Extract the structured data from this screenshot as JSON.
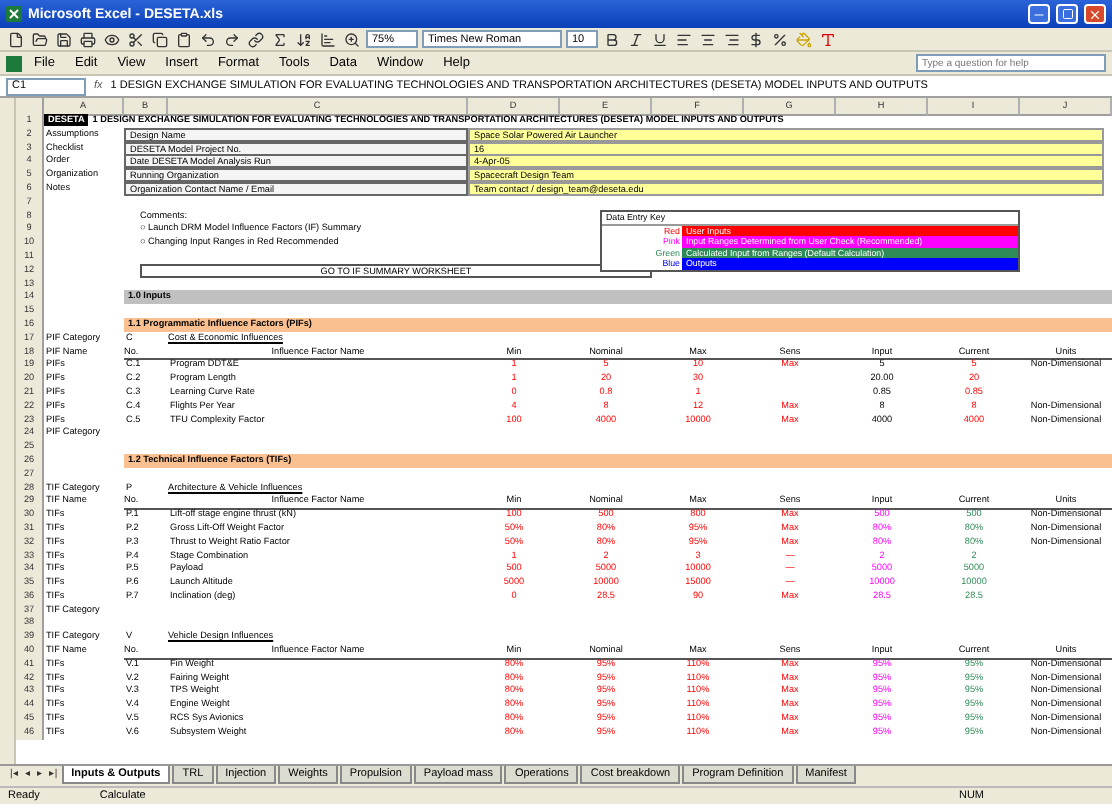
{
  "window": {
    "title": "Microsoft Excel - DESETA.xls"
  },
  "menu": [
    "File",
    "Edit",
    "View",
    "Insert",
    "Format",
    "Tools",
    "Data",
    "Window",
    "Help"
  ],
  "help_box": {
    "placeholder": "Type a question for help"
  },
  "toolbar": {
    "zoom": "75%",
    "font": "Times New Roman",
    "size": "10"
  },
  "formula_bar": {
    "name_box": "C1",
    "fx": "fx",
    "formula": "1 DESIGN EXCHANGE SIMULATION FOR EVALUATING TECHNOLOGIES AND TRANSPORTATION ARCHITECTURES (DESETA) MODEL INPUTS AND OUTPUTS"
  },
  "columns": [
    "A",
    "B",
    "C",
    "D",
    "E",
    "F",
    "G",
    "H",
    "I",
    "J"
  ],
  "data_entry_key": {
    "title": "Data Entry Key",
    "items": [
      {
        "label": "Red",
        "text": "User Inputs",
        "color": "#ff0000"
      },
      {
        "label": "Pink",
        "text": "Input Ranges Determined from User Check (Recommended)",
        "color": "#ff00ff"
      },
      {
        "label": "Green",
        "text": "Calculated Input from Ranges (Default Calculation)",
        "color": "#2e8b57"
      },
      {
        "label": "Blue",
        "text": "Outputs",
        "color": "#0000ff"
      }
    ]
  },
  "rows": [
    {
      "n": "1",
      "kind": "title",
      "badge": "DESETA",
      "text": "1 DESIGN EXCHANGE SIMULATION FOR EVALUATING TECHNOLOGIES AND TRANSPORTATION ARCHITECTURES (DESETA) MODEL INPUTS AND OUTPUTS"
    },
    {
      "n": "2",
      "kind": "info",
      "label": "Assumptions",
      "field": "Design Name",
      "value": "Space Solar Powered Air Launcher"
    },
    {
      "n": "3",
      "kind": "info",
      "label": "Checklist",
      "field": "DESETA Model Project No.",
      "value": "16"
    },
    {
      "n": "4",
      "kind": "info",
      "label": "Order",
      "field": "Date DESETA Model Analysis Run",
      "value": "4-Apr-05"
    },
    {
      "n": "5",
      "kind": "info",
      "label": "Organization",
      "field": "Running Organization",
      "value": "Spacecraft Design Team"
    },
    {
      "n": "6",
      "kind": "info",
      "label": "Notes",
      "field": "Organization Contact Name / Email",
      "value": "Team contact / design_team@deseta.edu"
    },
    {
      "n": "7",
      "kind": "blank"
    },
    {
      "n": "8",
      "kind": "note",
      "text": "Comments:"
    },
    {
      "n": "9",
      "kind": "note",
      "text": "○ Launch DRM Model Influence Factors (IF) Summary"
    },
    {
      "n": "10",
      "kind": "note",
      "text": "○ Changing Input Ranges in Red Recommended"
    },
    {
      "n": "11",
      "kind": "blank"
    },
    {
      "n": "12",
      "kind": "link",
      "text": "GO TO IF SUMMARY WORKSHEET"
    },
    {
      "n": "13",
      "kind": "blank"
    },
    {
      "n": "14",
      "kind": "section",
      "text": "1.0 Inputs"
    },
    {
      "n": "15",
      "kind": "blank"
    },
    {
      "n": "16",
      "kind": "subsection",
      "text": "1.1 Programmatic Influence Factors (PIFs)"
    },
    {
      "n": "17",
      "kind": "group",
      "label": "PIF Category",
      "code": "C",
      "text": "Cost & Economic Influences"
    },
    {
      "n": "18",
      "kind": "colhead",
      "label": "PIF Name",
      "cells": [
        "No.",
        "Influence Factor Name",
        "Min",
        "Nominal",
        "Max",
        "Sens",
        "Input",
        "Current",
        "Units"
      ]
    },
    {
      "n": "19",
      "kind": "data",
      "ranged": false,
      "label": "PIFs",
      "no": "C.1",
      "name": "Program DDT&E",
      "values": {
        "min": "1",
        "nominal": "5",
        "max": "10",
        "sens": "Max",
        "input": "5",
        "current": "5",
        "units": "Non-Dimensional"
      }
    },
    {
      "n": "20",
      "kind": "data",
      "ranged": false,
      "label": "PIFs",
      "no": "C.2",
      "name": "Program Length",
      "values": {
        "min": "1",
        "nominal": "20",
        "max": "30",
        "input": "20.00",
        "current": "20"
      }
    },
    {
      "n": "21",
      "kind": "data",
      "ranged": false,
      "label": "PIFs",
      "no": "C.3",
      "name": "Learning Curve Rate",
      "values": {
        "min": "0",
        "nominal": "0.8",
        "max": "1",
        "input": "0.85",
        "current": "0.85"
      }
    },
    {
      "n": "22",
      "kind": "data",
      "ranged": false,
      "label": "PIFs",
      "no": "C.4",
      "name": "Flights Per Year",
      "values": {
        "min": "4",
        "nominal": "8",
        "max": "12",
        "sens": "Max",
        "input": "8",
        "current": "8",
        "units": "Non-Dimensional"
      }
    },
    {
      "n": "23",
      "kind": "data",
      "ranged": false,
      "label": "PIFs",
      "no": "C.5",
      "name": "TFU Complexity Factor",
      "values": {
        "min": "100",
        "nominal": "4000",
        "max": "10000",
        "sens": "Max",
        "input": "4000",
        "current": "4000",
        "units": "Non-Dimensional"
      }
    },
    {
      "n": "24",
      "kind": "category",
      "label": "PIF Category"
    },
    {
      "n": "25",
      "kind": "blank"
    },
    {
      "n": "26",
      "kind": "subsection",
      "text": "1.2 Technical Influence Factors (TIFs)"
    },
    {
      "n": "27",
      "kind": "blank"
    },
    {
      "n": "28",
      "kind": "group",
      "label": "TIF Category",
      "code": "P",
      "text": "Architecture & Vehicle Influences"
    },
    {
      "n": "29",
      "kind": "colhead",
      "label": "TIF Name",
      "cells": [
        "No.",
        "Influence Factor Name",
        "Min",
        "Nominal",
        "Max",
        "Sens",
        "Input",
        "Current",
        "Units"
      ]
    },
    {
      "n": "30",
      "kind": "data",
      "ranged": true,
      "label": "TIFs",
      "no": "P.1",
      "name": "Lift-off stage engine thrust (kN)",
      "values": {
        "min": "100",
        "nominal": "500",
        "max": "800",
        "sens": "Max",
        "input": "500",
        "current": "500",
        "units": "Non-Dimensional"
      }
    },
    {
      "n": "31",
      "kind": "data",
      "ranged": true,
      "label": "TIFs",
      "no": "P.2",
      "name": "Gross Lift-Off Weight Factor",
      "values": {
        "min": "50%",
        "nominal": "80%",
        "max": "95%",
        "sens": "Max",
        "input": "80%",
        "current": "80%",
        "units": "Non-Dimensional"
      }
    },
    {
      "n": "32",
      "kind": "data",
      "ranged": true,
      "label": "TIFs",
      "no": "P.3",
      "name": "Thrust to Weight Ratio Factor",
      "values": {
        "min": "50%",
        "nominal": "80%",
        "max": "95%",
        "sens": "Max",
        "input": "80%",
        "current": "80%",
        "units": "Non-Dimensional"
      }
    },
    {
      "n": "33",
      "kind": "data",
      "ranged": true,
      "label": "TIFs",
      "no": "P.4",
      "name": "Stage Combination",
      "values": {
        "min": "1",
        "nominal": "2",
        "max": "3",
        "sens": "—",
        "input": "2",
        "current": "2"
      }
    },
    {
      "n": "34",
      "kind": "data",
      "ranged": true,
      "label": "TIFs",
      "no": "P.5",
      "name": "Payload",
      "values": {
        "min": "500",
        "nominal": "5000",
        "max": "10000",
        "sens": "—",
        "input": "5000",
        "current": "5000"
      }
    },
    {
      "n": "35",
      "kind": "data",
      "ranged": true,
      "label": "TIFs",
      "no": "P.6",
      "name": "Launch Altitude",
      "values": {
        "min": "5000",
        "nominal": "10000",
        "max": "15000",
        "sens": "—",
        "input": "10000",
        "current": "10000"
      }
    },
    {
      "n": "36",
      "kind": "data",
      "ranged": true,
      "label": "TIFs",
      "no": "P.7",
      "name": "Inclination (deg)",
      "values": {
        "min": "0",
        "nominal": "28.5",
        "max": "90",
        "sens": "Max",
        "input": "28.5",
        "current": "28.5"
      }
    },
    {
      "n": "37",
      "kind": "category",
      "label": "TIF Category"
    },
    {
      "n": "38",
      "kind": "blank"
    },
    {
      "n": "39",
      "kind": "group",
      "label": "TIF Category",
      "code": "V",
      "text": "Vehicle Design Influences"
    },
    {
      "n": "40",
      "kind": "colhead",
      "label": "TIF Name",
      "cells": [
        "No.",
        "Influence Factor Name",
        "Min",
        "Nominal",
        "Max",
        "Sens",
        "Input",
        "Current",
        "Units"
      ]
    },
    {
      "n": "41",
      "kind": "data",
      "ranged": true,
      "label": "TIFs",
      "no": "V.1",
      "name": "Fin Weight",
      "values": {
        "min": "80%",
        "nominal": "95%",
        "max": "110%",
        "sens": "Max",
        "input": "95%",
        "current": "95%",
        "units": "Non-Dimensional"
      }
    },
    {
      "n": "42",
      "kind": "data",
      "ranged": true,
      "label": "TIFs",
      "no": "V.2",
      "name": "Fairing Weight",
      "values": {
        "min": "80%",
        "nominal": "95%",
        "max": "110%",
        "sens": "Max",
        "input": "95%",
        "current": "95%",
        "units": "Non-Dimensional"
      }
    },
    {
      "n": "43",
      "kind": "data",
      "ranged": true,
      "label": "TIFs",
      "no": "V.3",
      "name": "TPS Weight",
      "values": {
        "min": "80%",
        "nominal": "95%",
        "max": "110%",
        "sens": "Max",
        "input": "95%",
        "current": "95%",
        "units": "Non-Dimensional"
      }
    },
    {
      "n": "44",
      "kind": "data",
      "ranged": true,
      "label": "TIFs",
      "no": "V.4",
      "name": "Engine Weight",
      "values": {
        "min": "80%",
        "nominal": "95%",
        "max": "110%",
        "sens": "Max",
        "input": "95%",
        "current": "95%",
        "units": "Non-Dimensional"
      }
    },
    {
      "n": "45",
      "kind": "data",
      "ranged": true,
      "label": "TIFs",
      "no": "V.5",
      "name": "RCS Sys Avionics",
      "values": {
        "min": "80%",
        "nominal": "95%",
        "max": "110%",
        "sens": "Max",
        "input": "95%",
        "current": "95%",
        "units": "Non-Dimensional"
      }
    },
    {
      "n": "46",
      "kind": "data",
      "ranged": true,
      "label": "TIFs",
      "no": "V.6",
      "name": "Subsystem Weight",
      "values": {
        "min": "80%",
        "nominal": "95%",
        "max": "110%",
        "sens": "Max",
        "input": "95%",
        "current": "95%",
        "units": "Non-Dimensional"
      }
    }
  ],
  "sheet_nav": [
    "|◂",
    "◂",
    "▸",
    "▸|"
  ],
  "sheet_tabs": [
    {
      "label": "Inputs & Outputs",
      "selected": true
    },
    {
      "label": "TRL",
      "selected": false
    },
    {
      "label": "Injection",
      "selected": false
    },
    {
      "label": "Weights",
      "selected": false
    },
    {
      "label": "Propulsion",
      "selected": false
    },
    {
      "label": "Payload mass",
      "selected": false
    },
    {
      "label": "Operations",
      "selected": false
    },
    {
      "label": "Cost breakdown",
      "selected": false
    },
    {
      "label": "Program Definition",
      "selected": false
    },
    {
      "label": "Manifest",
      "selected": false
    }
  ],
  "status_bar": {
    "left": "Ready",
    "mid": "Calculate",
    "right": "NUM"
  }
}
